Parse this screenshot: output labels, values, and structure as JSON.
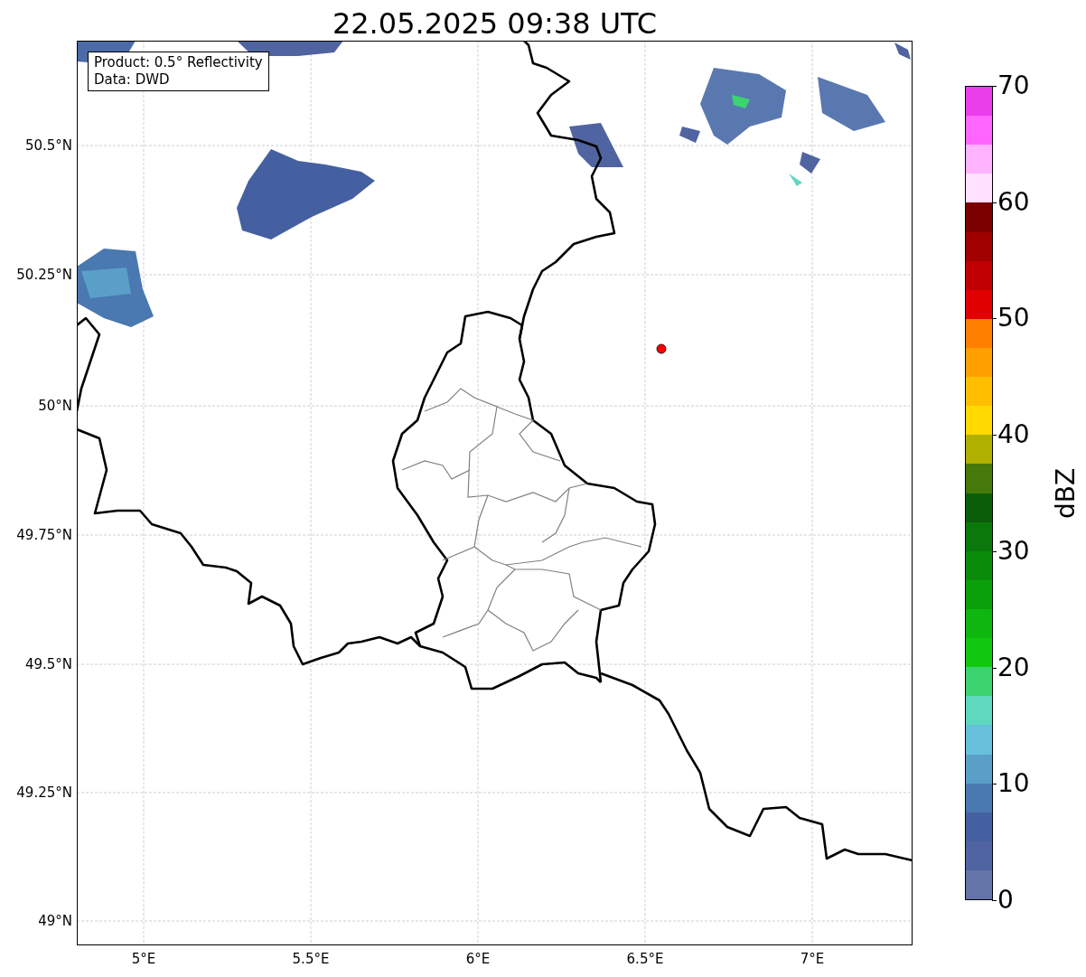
{
  "title": "22.05.2025 09:38 UTC",
  "info_box": [
    "Product: 0.5° Reflectivity",
    "Data: DWD"
  ],
  "x_ticks": [
    "5°E",
    "5.5°E",
    "6°E",
    "6.5°E",
    "7°E"
  ],
  "y_ticks": [
    "50.5°N",
    "50.25°N",
    "50°N",
    "49.75°N",
    "49.5°N",
    "49.25°N",
    "49°N"
  ],
  "colorbar": {
    "label": "dBZ",
    "ticks": [
      "70",
      "60",
      "50",
      "40",
      "30",
      "20",
      "10",
      "0"
    ],
    "bands": [
      {
        "color": "#e93ee9"
      },
      {
        "color": "#ff66ff"
      },
      {
        "color": "#ffb3ff"
      },
      {
        "color": "#ffe0ff"
      },
      {
        "color": "#7a0000"
      },
      {
        "color": "#a00000"
      },
      {
        "color": "#c00000"
      },
      {
        "color": "#e00000"
      },
      {
        "color": "#ff7f00"
      },
      {
        "color": "#ff9f00"
      },
      {
        "color": "#ffbf00"
      },
      {
        "color": "#ffd900"
      },
      {
        "color": "#b0b000"
      },
      {
        "color": "#457a0a"
      },
      {
        "color": "#0a5e0a"
      },
      {
        "color": "#0a780a"
      },
      {
        "color": "#0a8c0a"
      },
      {
        "color": "#0aa00a"
      },
      {
        "color": "#10b610"
      },
      {
        "color": "#10c810"
      },
      {
        "color": "#3cd46e"
      },
      {
        "color": "#5fd8c0"
      },
      {
        "color": "#66c0dc"
      },
      {
        "color": "#5a9fc8"
      },
      {
        "color": "#4a78b0"
      },
      {
        "color": "#4560a0"
      },
      {
        "color": "#4f64a0"
      },
      {
        "color": "#6574a8"
      }
    ]
  }
}
